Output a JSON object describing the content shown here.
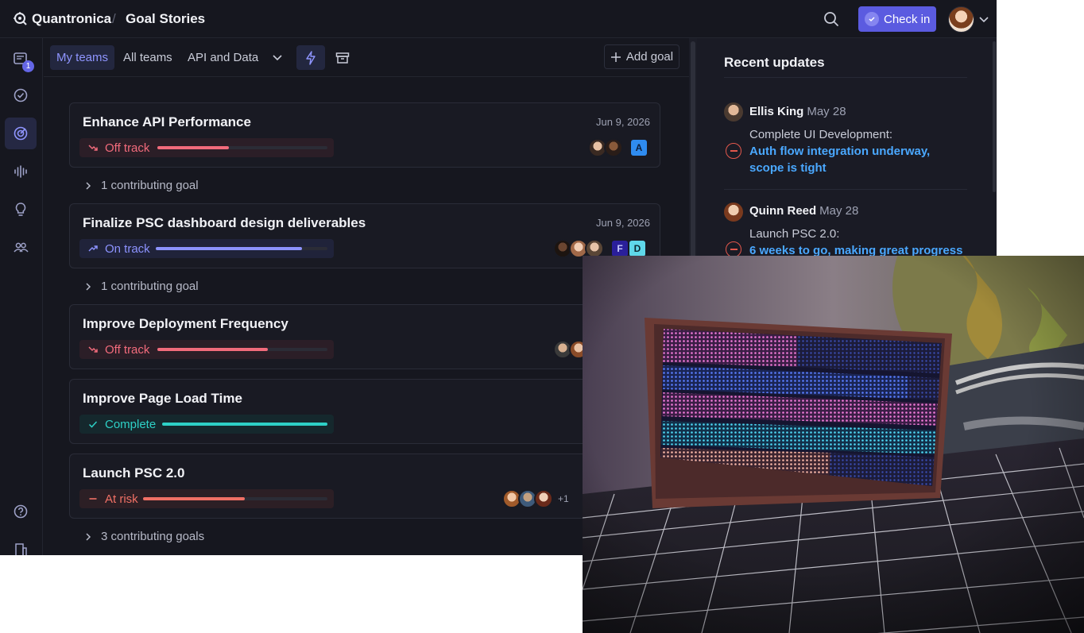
{
  "app": {
    "brand": "Quantronica",
    "breadcrumb_separator": "/",
    "page": "Goal Stories",
    "check_in_label": "Check in",
    "inbox_badge": "1",
    "accent": "#5b5be0"
  },
  "tabs": {
    "my_teams": "My teams",
    "all_teams": "All teams",
    "api_and_data": "API and Data",
    "add_goal": "Add goal"
  },
  "goals": [
    {
      "title": "Enhance API Performance",
      "date": "Jun 9, 2026",
      "status": "Off track",
      "progress": 0.42,
      "chips": [
        "A"
      ],
      "contrib": "1 contributing goal"
    },
    {
      "title": "Finalize PSC dashboard design deliverables",
      "date": "Jun 9, 2026",
      "status": "On track",
      "progress": 0.85,
      "chips": [
        "F",
        "D"
      ],
      "contrib": "1 contributing goal"
    },
    {
      "title": "Improve Deployment Frequency",
      "status": "Off track",
      "progress": 0.65
    },
    {
      "title": "Improve Page Load Time",
      "status": "Complete",
      "progress": 1.0
    },
    {
      "title": "Launch PSC 2.0",
      "status": "At risk",
      "progress": 0.55,
      "more_avatars": "+1",
      "contrib": "3 contributing goals"
    }
  ],
  "status_colors": {
    "off_track": "#f26b7c",
    "on_track": "#8d93ff",
    "complete": "#2ed0c6",
    "at_risk": "#f07065"
  },
  "updates": {
    "title": "Recent updates",
    "items": [
      {
        "author": "Ellis King",
        "date": "May 28",
        "goal": "Complete UI Development:",
        "text": "Auth flow integration underway, scope is tight"
      },
      {
        "author": "Quinn Reed",
        "date": "May 28",
        "goal": "Launch PSC 2.0:",
        "text": "6 weeks to go, making great progress"
      }
    ]
  }
}
